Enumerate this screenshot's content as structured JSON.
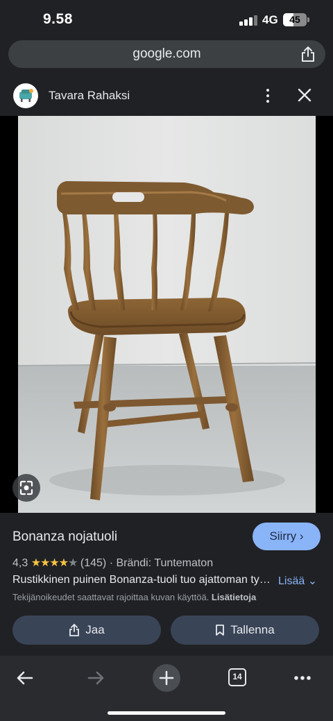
{
  "status": {
    "time": "9.58",
    "network": "4G",
    "battery": "45",
    "battery_level": 0.45
  },
  "browser": {
    "url": "google.com",
    "tabs": "14"
  },
  "source": {
    "name": "Tavara Rahaksi"
  },
  "product": {
    "title": "Bonanza nojatuoli",
    "visit_label": "Siirry",
    "rating": "4,3",
    "rating_value": 4.3,
    "reviews": "(145)",
    "brand": "· Brändi: Tuntematon",
    "description": "Rustikkinen puinen Bonanza-tuoli tuo ajattoman tyy…",
    "more_label": "Lisää",
    "copyright": "Tekijänoikeudet saattavat rajoittaa kuvan käyttöä.",
    "details_label": "Lisätietoja",
    "share_label": "Jaa",
    "save_label": "Tallenna"
  },
  "colors": {
    "accent": "#8ab4f8",
    "star": "#f6c344",
    "pill": "#394457"
  }
}
